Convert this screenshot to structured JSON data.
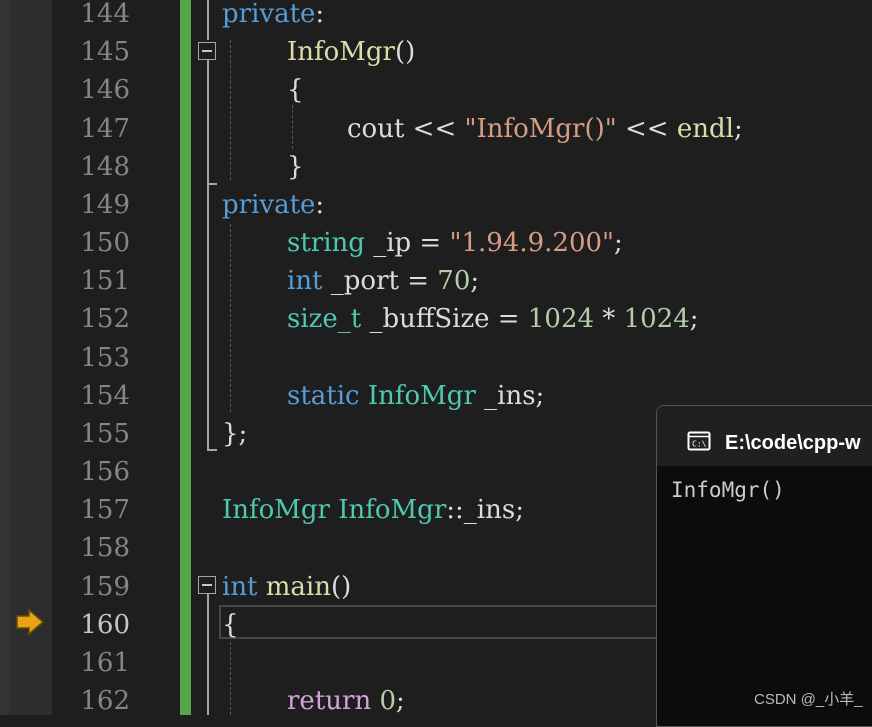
{
  "editor": {
    "line_numbers": [
      "144",
      "145",
      "146",
      "147",
      "148",
      "149",
      "150",
      "151",
      "152",
      "153",
      "154",
      "155",
      "156",
      "157",
      "158",
      "159",
      "160",
      "161",
      "162"
    ],
    "current_line": "160",
    "colors": {
      "keyword": "#569cd6",
      "type": "#4ec9b0",
      "function": "#dcdcaa",
      "string": "#d69d85",
      "number": "#b5cea8",
      "control": "#d8a0df",
      "change_bar": "#57a64a",
      "breakpoint_arrow": "#e8a317"
    },
    "code": {
      "l144": {
        "kw": "private",
        "p": ":"
      },
      "l145": {
        "fn": "InfoMgr",
        "p": "()"
      },
      "l146": {
        "p": "{"
      },
      "l147": {
        "a": "cout",
        "b": " << ",
        "s": "\"InfoMgr()\"",
        "c": " << ",
        "d": "endl",
        "e": ";"
      },
      "l148": {
        "p": "}"
      },
      "l149": {
        "kw": "private",
        "p": ":"
      },
      "l150": {
        "t": "string",
        "a": " _ip = ",
        "s": "\"1.94.9.200\"",
        "e": ";"
      },
      "l151": {
        "kw": "int",
        "a": " _port = ",
        "n": "70",
        "e": ";"
      },
      "l152": {
        "t": "size_t",
        "a": " _buffSize = ",
        "n1": "1024",
        "b": " * ",
        "n2": "1024",
        "e": ";"
      },
      "l154": {
        "kw": "static",
        "t": "InfoMgr",
        "a": " _ins;"
      },
      "l155": {
        "p": "};"
      },
      "l157": {
        "t1": "InfoMgr",
        "t2": "InfoMgr",
        "a": "::_ins;"
      },
      "l159": {
        "kw": "int",
        "fn": "main",
        "p": "()"
      },
      "l160": {
        "p": "{"
      },
      "l162": {
        "kw": "return",
        "n": "0",
        "e": ";"
      }
    }
  },
  "console": {
    "title": "E:\\code\\cpp-w",
    "output": "InfoMgr()",
    "icon": "terminal-icon"
  },
  "watermark": "CSDN @_小羊_"
}
